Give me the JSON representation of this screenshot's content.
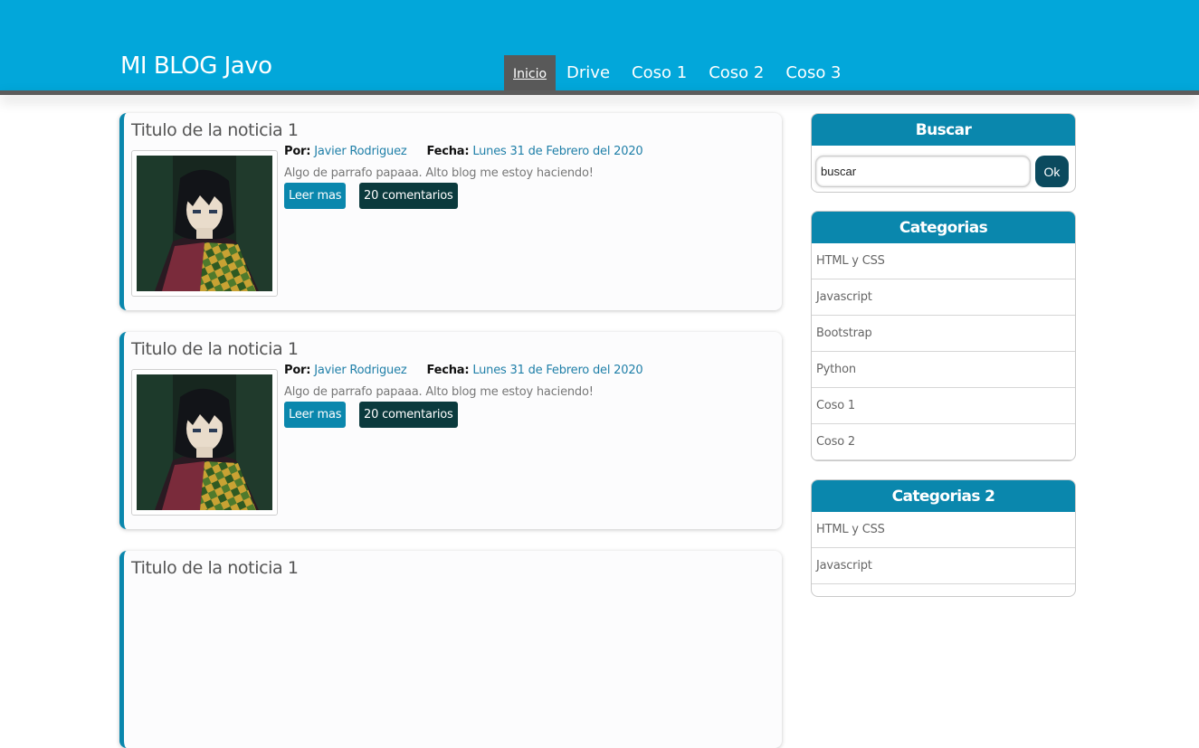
{
  "header": {
    "title": "MI BLOG Javo",
    "nav": [
      {
        "label": "Inicio",
        "active": true
      },
      {
        "label": "Drive",
        "active": false
      },
      {
        "label": "Coso 1",
        "active": false
      },
      {
        "label": "Coso 2",
        "active": false
      },
      {
        "label": "Coso 3",
        "active": false
      }
    ]
  },
  "posts": [
    {
      "title": "Titulo de la noticia 1",
      "author_label": "Por:",
      "author": "Javier Rodriguez",
      "date_label": "Fecha:",
      "date": "Lunes 31 de Febrero del 2020",
      "excerpt": "Algo de parrafo papaaa. Alto blog me estoy haciendo!",
      "read_more": "Leer mas",
      "comments": "20 comentarios"
    },
    {
      "title": "Titulo de la noticia 1",
      "author_label": "Por:",
      "author": "Javier Rodriguez",
      "date_label": "Fecha:",
      "date": "Lunes 31 de Febrero del 2020",
      "excerpt": "Algo de parrafo papaaa. Alto blog me estoy haciendo!",
      "read_more": "Leer mas",
      "comments": "20 comentarios"
    },
    {
      "title": "Titulo de la noticia 1"
    }
  ],
  "sidebar": {
    "search": {
      "title": "Buscar",
      "value": "buscar",
      "button": "Ok"
    },
    "categories": {
      "title": "Categorias",
      "items": [
        "HTML y CSS",
        "Javascript",
        "Bootstrap",
        "Python",
        "Coso 1",
        "Coso 2"
      ]
    },
    "categories2": {
      "title": "Categorias 2",
      "items": [
        "HTML y CSS",
        "Javascript"
      ]
    }
  },
  "colors": {
    "header": "#02a7da",
    "accent": "#0a87ad",
    "dark_button": "#0b3a3d",
    "nav_active": "#595959"
  }
}
